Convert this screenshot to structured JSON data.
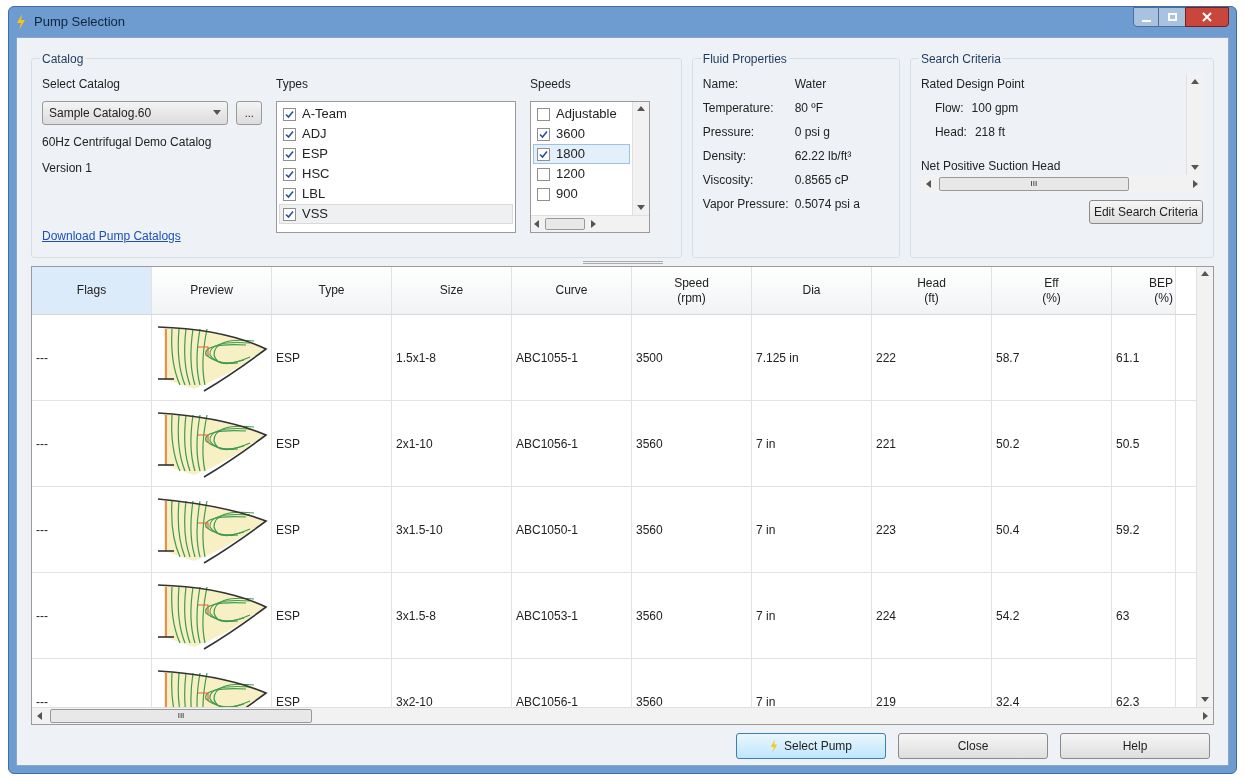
{
  "window": {
    "title": "Pump Selection"
  },
  "catalog": {
    "title": "Catalog",
    "select_label": "Select Catalog",
    "selected_catalog": "Sample Catalog.60",
    "browse_button": "...",
    "description": "60Hz Centrifugal Demo Catalog",
    "version": "Version 1",
    "download_link": "Download Pump Catalogs"
  },
  "types": {
    "title": "Types",
    "items": [
      {
        "label": "A-Team",
        "checked": true,
        "selected": false
      },
      {
        "label": "ADJ",
        "checked": true,
        "selected": false
      },
      {
        "label": "ESP",
        "checked": true,
        "selected": false
      },
      {
        "label": "HSC",
        "checked": true,
        "selected": false
      },
      {
        "label": "LBL",
        "checked": true,
        "selected": false
      },
      {
        "label": "VSS",
        "checked": true,
        "selected": true
      }
    ]
  },
  "speeds": {
    "title": "Speeds",
    "items": [
      {
        "label": "Adjustable",
        "checked": false,
        "selected": false
      },
      {
        "label": "3600",
        "checked": true,
        "selected": false
      },
      {
        "label": "1800",
        "checked": true,
        "selected": true
      },
      {
        "label": "1200",
        "checked": false,
        "selected": false
      },
      {
        "label": "900",
        "checked": false,
        "selected": false
      }
    ]
  },
  "fluid_properties": {
    "title": "Fluid Properties",
    "rows": [
      {
        "label": "Name:",
        "value": "Water"
      },
      {
        "label": "Temperature:",
        "value": "80 ºF"
      },
      {
        "label": "Pressure:",
        "value": "0 psi g"
      },
      {
        "label": "Density:",
        "value": "62.22 lb/ft³"
      },
      {
        "label": "Viscosity:",
        "value": "0.8565 cP"
      },
      {
        "label": "Vapor Pressure:",
        "value": "0.5074 psi a"
      }
    ]
  },
  "search_criteria": {
    "title": "Search Criteria",
    "heading": "Rated Design Point",
    "rows": [
      {
        "label": "Flow:",
        "value": "100 gpm"
      },
      {
        "label": "Head:",
        "value": "218 ft"
      }
    ],
    "subheading": "Net Positive Suction Head",
    "edit_button": "Edit Search Criteria",
    "scroll_glyph": "III"
  },
  "table": {
    "columns": [
      {
        "label": "Flags",
        "selected": true
      },
      {
        "label": "Preview",
        "selected": false
      },
      {
        "label": "Type",
        "selected": false
      },
      {
        "label": "Size",
        "selected": false
      },
      {
        "label": "Curve",
        "selected": false
      },
      {
        "label": "Speed\n(rpm)",
        "selected": false
      },
      {
        "label": "Dia",
        "selected": false
      },
      {
        "label": "Head\n(ft)",
        "selected": false
      },
      {
        "label": "Eff\n(%)",
        "selected": false
      },
      {
        "label": "BEP\n(%)",
        "selected": false
      }
    ],
    "rows": [
      {
        "flags": "---",
        "type": "ESP",
        "size": "1.5x1-8",
        "curve": "ABC1055-1",
        "speed": "3500",
        "dia": "7.125 in",
        "head": "222",
        "eff": "58.7",
        "bep": "61.1"
      },
      {
        "flags": "---",
        "type": "ESP",
        "size": "2x1-10",
        "curve": "ABC1056-1",
        "speed": "3560",
        "dia": "7 in",
        "head": "221",
        "eff": "50.2",
        "bep": "50.5"
      },
      {
        "flags": "---",
        "type": "ESP",
        "size": "3x1.5-10",
        "curve": "ABC1050-1",
        "speed": "3560",
        "dia": "7 in",
        "head": "223",
        "eff": "50.4",
        "bep": "59.2"
      },
      {
        "flags": "---",
        "type": "ESP",
        "size": "3x1.5-8",
        "curve": "ABC1053-1",
        "speed": "3560",
        "dia": "7 in",
        "head": "224",
        "eff": "54.2",
        "bep": "63"
      },
      {
        "flags": "---",
        "type": "ESP",
        "size": "3x2-10",
        "curve": "ABC1056-1",
        "speed": "3560",
        "dia": "7 in",
        "head": "219",
        "eff": "32.4",
        "bep": "62.3"
      }
    ],
    "scroll_glyph": "III"
  },
  "buttons": [
    {
      "label": "Select Pump",
      "kind": "primary"
    },
    {
      "label": "Close",
      "kind": "normal"
    },
    {
      "label": "Help",
      "kind": "normal"
    }
  ]
}
